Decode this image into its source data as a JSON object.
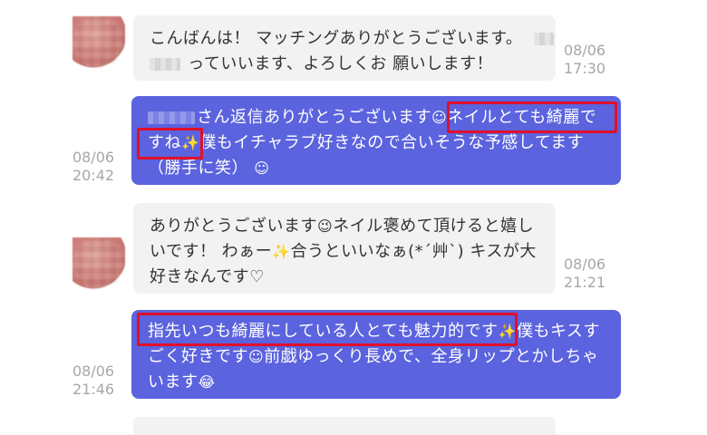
{
  "colors": {
    "incoming_bg": "#f2f2f2",
    "outgoing_bg": "#5b63de",
    "highlight": "#e10f2b",
    "time_text": "#a7a7a7"
  },
  "messages": [
    {
      "id": "m1",
      "direction": "incoming",
      "lines": [
        "こんばんは！ マッチングありがとうございます。",
        "っていいます、よろしくお 願いします！"
      ],
      "time": {
        "date": "08/06",
        "clock": "17:30"
      }
    },
    {
      "id": "m2",
      "direction": "outgoing",
      "line1_a": "さん返信ありがとうございます",
      "line1_b": "ネイルとても綺麗で",
      "line2_a": "すね",
      "line2_b": "僕もイチャラブ好きなので合いそうな予感してます",
      "line3": "（勝手に笑）",
      "emoji_1": "☺",
      "emoji_2": "✨",
      "emoji_3": "☺",
      "time": {
        "date": "08/06",
        "clock": "20:42"
      }
    },
    {
      "id": "m3",
      "direction": "incoming",
      "line1_a": "ありがとうございます",
      "line1_b": "ネイル褒めて頂けると嬉し",
      "line2_a": "いです！ わぁー",
      "line2_b": "合うといいなぁ(*´艸`) キスが大",
      "line3": "好きなんです♡",
      "emoji_1": "😉",
      "emoji_2": "✨",
      "time": {
        "date": "08/06",
        "clock": "21:21"
      }
    },
    {
      "id": "m4",
      "direction": "outgoing",
      "line1_a": "指先いつも綺麗にしている人とても魅力的です",
      "line1_b": "僕もキスす",
      "line2_a": "ごく好きです",
      "line2_b": "前戯ゆっくり長めで、全身リップとかしちゃ",
      "line3_a": "います",
      "emoji_1": "✨",
      "emoji_2": "☺",
      "emoji_3": "😂",
      "time": {
        "date": "08/06",
        "clock": "21:46"
      }
    }
  ]
}
